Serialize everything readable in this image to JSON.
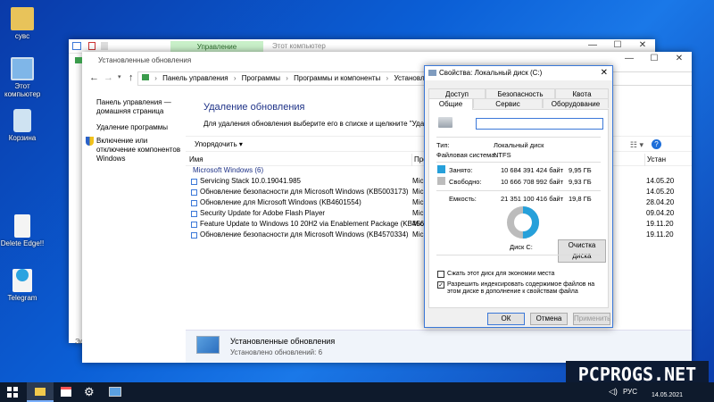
{
  "desktop": {
    "icons": [
      {
        "label": "сувс"
      },
      {
        "label": "Этот компьютер"
      },
      {
        "label": "Корзина"
      },
      {
        "label": "Delete Edge!!"
      },
      {
        "label": "Telegram"
      }
    ]
  },
  "back_window": {
    "ribbon_tab": "Управление",
    "title": "Этот компьютер"
  },
  "updates_window": {
    "title": "Установленные обновления",
    "breadcrumb": [
      "Панель управления",
      "Программы",
      "Программы и компоненты",
      "Установленные обнов"
    ],
    "sidebar": {
      "home_link": "Панель управления — домашняя страница",
      "programs_link": "Удаление программы",
      "features_link": "Включение или отключение компонентов Windows"
    },
    "heading": "Удаление обновления",
    "description": "Для удаления обновления выберите его в списке и щелкните \"Удалить\" или",
    "organize": "Упорядочить",
    "columns": {
      "name": "Имя",
      "program": "Програ",
      "date": "Устан"
    },
    "group": "Microsoft Windows (6)",
    "rows": [
      {
        "name": "Servicing Stack 10.0.19041.985",
        "program": "Micr",
        "date": "14.05.20"
      },
      {
        "name": "Обновление безопасности для Microsoft Windows (KB5003173)",
        "program": "Micr",
        "date": "14.05.20"
      },
      {
        "name": "Обновление для Microsoft Windows (KB4601554)",
        "program": "Micr",
        "date": "28.04.20"
      },
      {
        "name": "Security Update for Adobe Flash Player",
        "program": "Micr",
        "date": "09.04.20"
      },
      {
        "name": "Feature Update to Windows 10 20H2 via Enablement Package (KB4562830)",
        "program": "Micr",
        "date": "19.11.20"
      },
      {
        "name": "Обновление безопасности для Microsoft Windows (KB4570334)",
        "program": "Micr",
        "date": "19.11.20"
      }
    ],
    "footer": {
      "title": "Установленные обновления",
      "subtitle": "Установлено обновлений: 6"
    },
    "left_edge_text": "Эл"
  },
  "props_dialog": {
    "title": "Свойства: Локальный диск (C:)",
    "tabs_top": [
      "Доступ",
      "Безопасность",
      "Квота"
    ],
    "tabs_bottom": [
      "Общие",
      "Сервис",
      "Оборудование"
    ],
    "name_value": "",
    "type_label": "Тип:",
    "type_value": "Локальный диск",
    "fs_label": "Файловая система:",
    "fs_value": "NTFS",
    "used_label": "Занято:",
    "used_bytes": "10 684 391 424 байт",
    "used_gb": "9,95 ГБ",
    "free_label": "Свободно:",
    "free_bytes": "10 666 708 992 байт",
    "free_gb": "9,93 ГБ",
    "capacity_label": "Емкость:",
    "capacity_bytes": "21 351 100 416 байт",
    "capacity_gb": "19,8 ГБ",
    "disk_label": "Диск С:",
    "cleanup_button": "Очистка диска",
    "compress_label": "Сжать этот диск для экономии места",
    "compress_checked": false,
    "index_label": "Разрешить индексировать содержимое файлов на этом диске в дополнение к свойствам файла",
    "index_checked": true,
    "ok_button": "ОК",
    "cancel_button": "Отмена",
    "apply_button": "Применить",
    "used_fraction": 0.5004,
    "colors": {
      "used": "#26a0da",
      "free": "#bcbcbc"
    }
  },
  "taskbar": {
    "lang": "РУС",
    "date": "14.05.2021"
  },
  "watermark": "PCPROGS.NET"
}
